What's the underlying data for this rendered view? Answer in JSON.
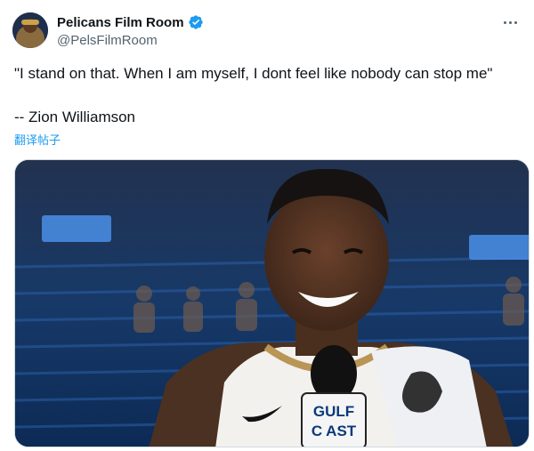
{
  "author": {
    "display_name": "Pelicans Film Room",
    "handle": "@PelsFilmRoom",
    "verified": true,
    "avatar_icon": "team-logo-avatar"
  },
  "tweet": {
    "line1": "\"I stand on that. When I am myself, I dont feel like nobody can stop me\"",
    "line2": "-- Zion Williamson",
    "translate_label": "翻译帖子"
  },
  "media": {
    "mic_flag_text_1": "GULF",
    "mic_flag_text_2": "C AST"
  },
  "colors": {
    "accent": "#1d9bf0",
    "text": "#0f1419",
    "muted": "#536471"
  }
}
